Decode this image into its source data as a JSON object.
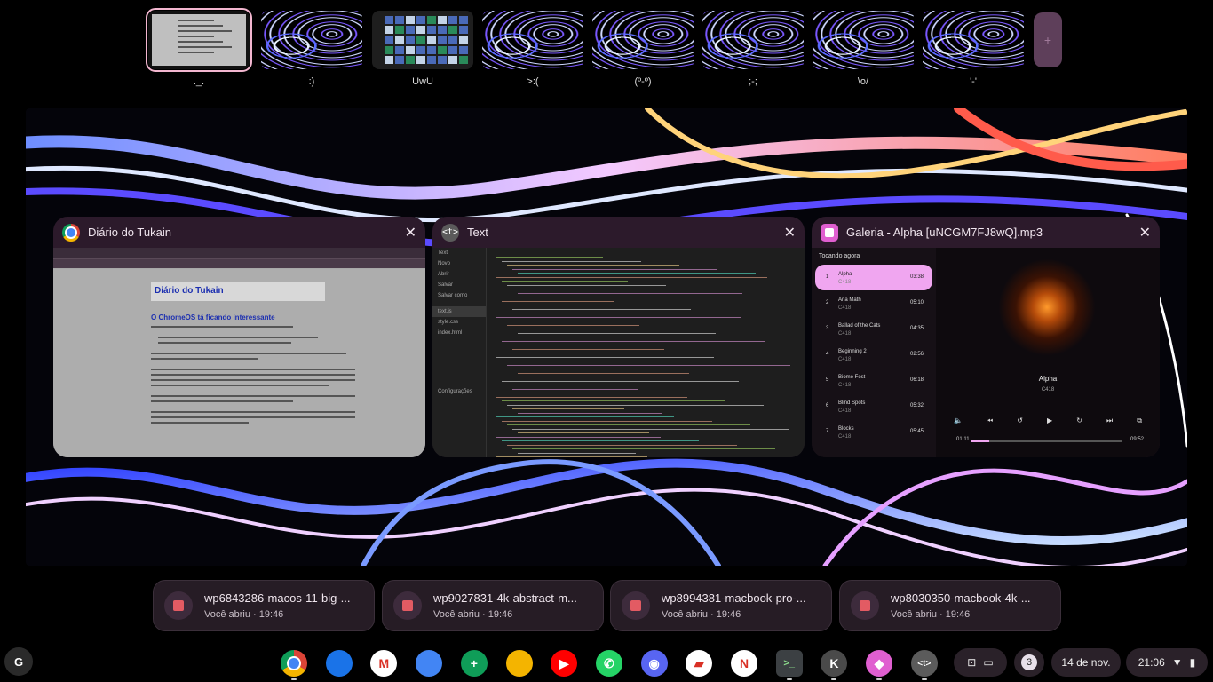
{
  "desks": [
    {
      "label": "._.",
      "type": "doc",
      "active": true
    },
    {
      "label": ":)",
      "type": "wall"
    },
    {
      "label": "UwU",
      "type": "grid"
    },
    {
      "label": ">:(",
      "type": "wall"
    },
    {
      "label": "(º-º)",
      "type": "wall"
    },
    {
      "label": ";-;",
      "type": "wall"
    },
    {
      "label": "\\o/",
      "type": "wall"
    },
    {
      "label": "'-'",
      "type": "wall"
    }
  ],
  "new_desk_icon": "plus-icon",
  "windows": {
    "chrome": {
      "title": "Diário do Tukain",
      "page_banner": "Diário do Tukain",
      "article_heading": "O ChromeOS tá ficando interessante"
    },
    "text": {
      "title": "Text",
      "sidebar_header": "Text",
      "sidebar_items": [
        "Novo",
        "Abrir",
        "Salvar",
        "Salvar como",
        "",
        "text.js",
        "style.css",
        "index.html",
        "",
        "",
        "",
        "",
        "",
        "",
        "",
        "",
        "",
        "Configurações"
      ]
    },
    "gallery": {
      "title": "Galeria - Alpha [uNCGM7FJ8wQ].mp3",
      "list_header": "Tocando agora",
      "tracks": [
        {
          "n": "1",
          "title": "Alpha",
          "artist": "C418",
          "dur": "03:38",
          "current": true
        },
        {
          "n": "2",
          "title": "Aria Math",
          "artist": "C418",
          "dur": "05:10"
        },
        {
          "n": "3",
          "title": "Ballad of the Cats",
          "artist": "C418",
          "dur": "04:35"
        },
        {
          "n": "4",
          "title": "Beginning 2",
          "artist": "C418",
          "dur": "02:56"
        },
        {
          "n": "5",
          "title": "Biome Fest",
          "artist": "C418",
          "dur": "06:18"
        },
        {
          "n": "6",
          "title": "Blind Spots",
          "artist": "C418",
          "dur": "05:32"
        },
        {
          "n": "7",
          "title": "Blocks",
          "artist": "C418",
          "dur": "05:45"
        }
      ],
      "now_playing": {
        "title": "Alpha",
        "artist": "C418",
        "elapsed": "01:11",
        "remaining": "09:52",
        "progress": 0.12
      }
    }
  },
  "recent_files": [
    {
      "name": "wp6843286-macos-11-big-...",
      "sub": "Você abriu · 19:46"
    },
    {
      "name": "wp9027831-4k-abstract-m...",
      "sub": "Você abriu · 19:46"
    },
    {
      "name": "wp8994381-macbook-pro-...",
      "sub": "Você abriu · 19:46"
    },
    {
      "name": "wp8030350-macbook-4k-...",
      "sub": "Você abriu · 19:46"
    }
  ],
  "shelf": {
    "launcher": "G",
    "apps": [
      {
        "name": "chrome-icon",
        "color": "#ffffff",
        "glyph": ""
      },
      {
        "name": "files-icon",
        "color": "#1a73e8",
        "glyph": ""
      },
      {
        "name": "gmail-icon",
        "color": "#ffffff",
        "glyph": "M"
      },
      {
        "name": "docs-icon",
        "color": "#4285f4",
        "glyph": ""
      },
      {
        "name": "sheets-icon",
        "color": "#0f9d58",
        "glyph": "+"
      },
      {
        "name": "slides-icon",
        "color": "#f4b400",
        "glyph": ""
      },
      {
        "name": "youtube-icon",
        "color": "#ff0000",
        "glyph": "▶"
      },
      {
        "name": "whatsapp-icon",
        "color": "#25d366",
        "glyph": "✆"
      },
      {
        "name": "discord-icon",
        "color": "#5865f2",
        "glyph": "◉"
      },
      {
        "name": "zoom-icon",
        "color": "#ffffff",
        "glyph": "▰"
      },
      {
        "name": "netflix-icon",
        "color": "#ffffff",
        "glyph": "N"
      },
      {
        "name": "terminal-icon",
        "color": "#3c4043",
        "glyph": ">_"
      },
      {
        "name": "kde-icon",
        "color": "#4a4a4a",
        "glyph": "K"
      },
      {
        "name": "gallery-icon",
        "color": "#e05fd0",
        "glyph": "◆"
      },
      {
        "name": "text-icon",
        "color": "#5b5b5b",
        "glyph": "<t>"
      }
    ],
    "notification_count": "3",
    "date": "14 de nov.",
    "time": "21:06"
  }
}
